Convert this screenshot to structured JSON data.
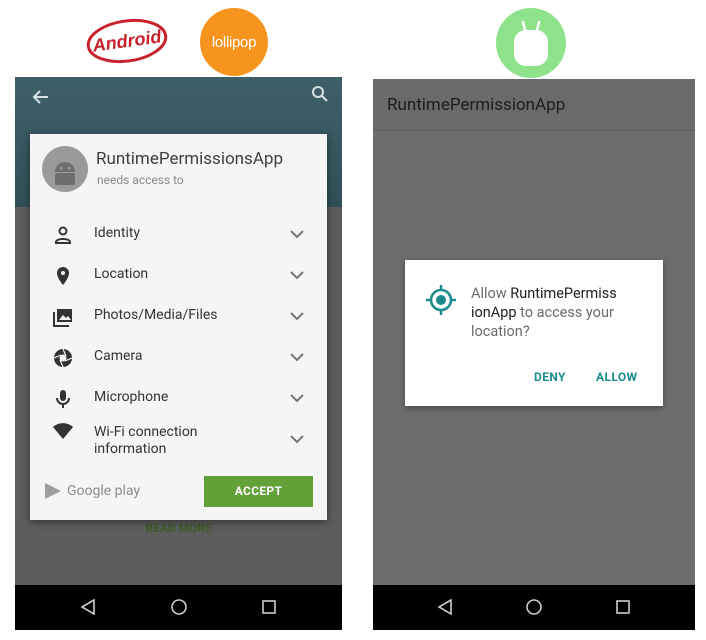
{
  "logos": {
    "android_text": "Android",
    "lollipop_text": "lollipop"
  },
  "left_phone": {
    "app_name": "RuntimePermissionsApp",
    "subtitle": "needs access to",
    "permissions": [
      {
        "label": "Identity",
        "icon": "person-icon"
      },
      {
        "label": "Location",
        "icon": "location-pin-icon"
      },
      {
        "label": "Photos/Media/Files",
        "icon": "photos-icon"
      },
      {
        "label": "Camera",
        "icon": "camera-aperture-icon"
      },
      {
        "label": "Microphone",
        "icon": "microphone-icon"
      },
      {
        "label_line1": "Wi-Fi connection",
        "label_line2": "information",
        "icon": "wifi-icon"
      }
    ],
    "store_label": "Google play",
    "accept_label": "ACCEPT",
    "read_more": "READ MORE"
  },
  "right_phone": {
    "appbar_title": "RuntimePermissionApp",
    "dialog": {
      "text_prefix": "Allow ",
      "app_name_line1": "RuntimePermiss",
      "app_name_line2": "ionApp",
      "text_suffix_line2": " to access your",
      "text_line3": "location?",
      "deny_label": "DENY",
      "allow_label": "ALLOW"
    }
  },
  "colors": {
    "accept_green": "#62a03a",
    "teal_accent": "#1a8a8c",
    "lollipop_orange": "#f7941d",
    "marshmallow_green": "#8ee28a",
    "android_red": "#c8232c"
  }
}
